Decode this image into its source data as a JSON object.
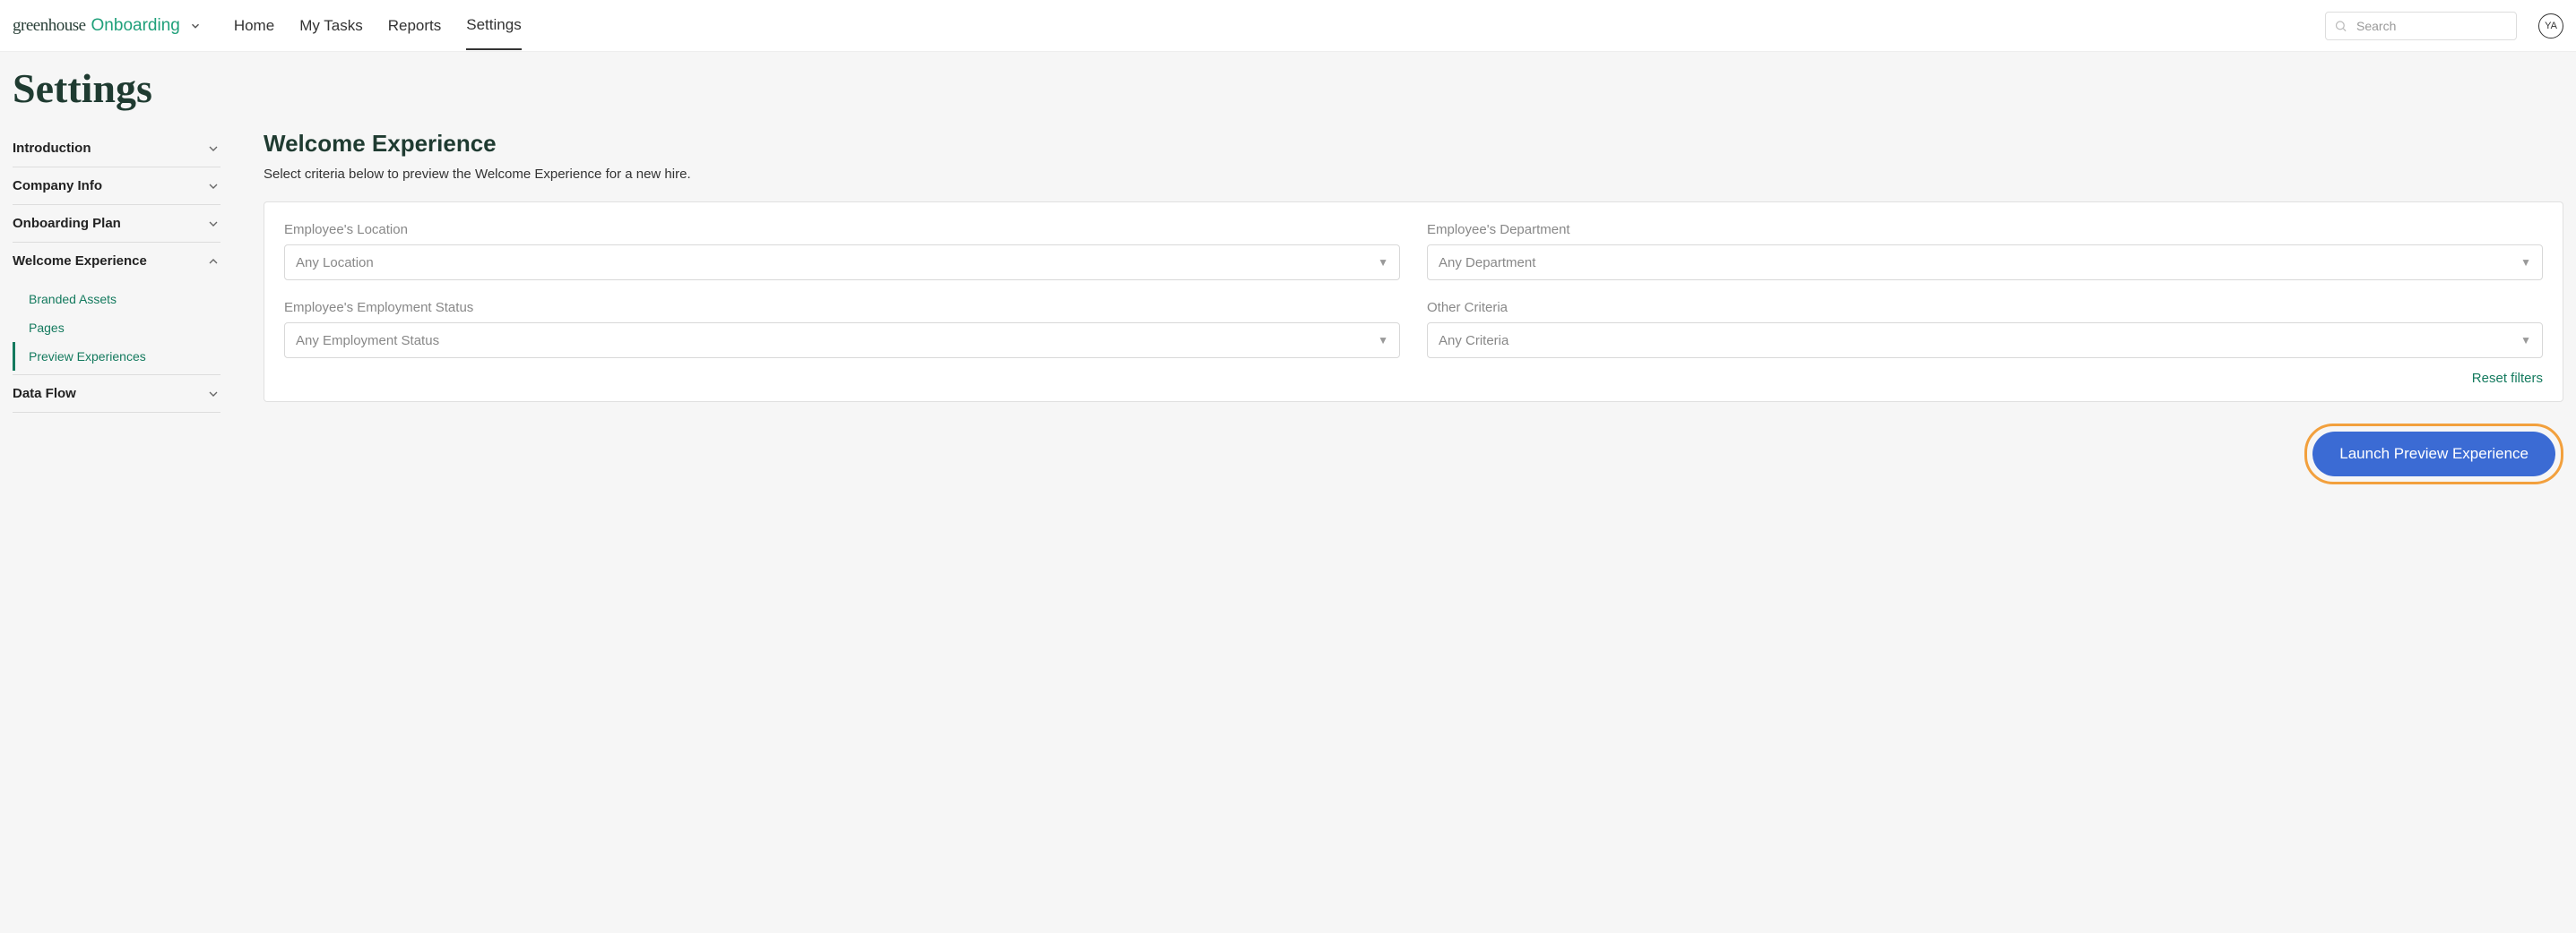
{
  "brand": {
    "part1": "greenhouse",
    "part2": "Onboarding"
  },
  "nav": {
    "items": [
      {
        "label": "Home"
      },
      {
        "label": "My Tasks"
      },
      {
        "label": "Reports"
      },
      {
        "label": "Settings"
      }
    ],
    "active_index": 3
  },
  "search": {
    "placeholder": "Search"
  },
  "user": {
    "initials": "YA"
  },
  "page_title": "Settings",
  "sidebar": {
    "items": [
      {
        "label": "Introduction",
        "expanded": false
      },
      {
        "label": "Company Info",
        "expanded": false
      },
      {
        "label": "Onboarding Plan",
        "expanded": false
      },
      {
        "label": "Welcome Experience",
        "expanded": true,
        "children": [
          {
            "label": "Branded Assets"
          },
          {
            "label": "Pages"
          },
          {
            "label": "Preview Experiences",
            "active": true
          }
        ]
      },
      {
        "label": "Data Flow",
        "expanded": false
      }
    ]
  },
  "main": {
    "title": "Welcome Experience",
    "description": "Select criteria below to preview the Welcome Experience for a new hire.",
    "fields": [
      {
        "label": "Employee's Location",
        "value": "Any Location"
      },
      {
        "label": "Employee's Department",
        "value": "Any Department"
      },
      {
        "label": "Employee's Employment Status",
        "value": "Any Employment Status"
      },
      {
        "label": "Other Criteria",
        "value": "Any Criteria"
      }
    ],
    "reset_label": "Reset filters",
    "launch_label": "Launch Preview Experience"
  }
}
